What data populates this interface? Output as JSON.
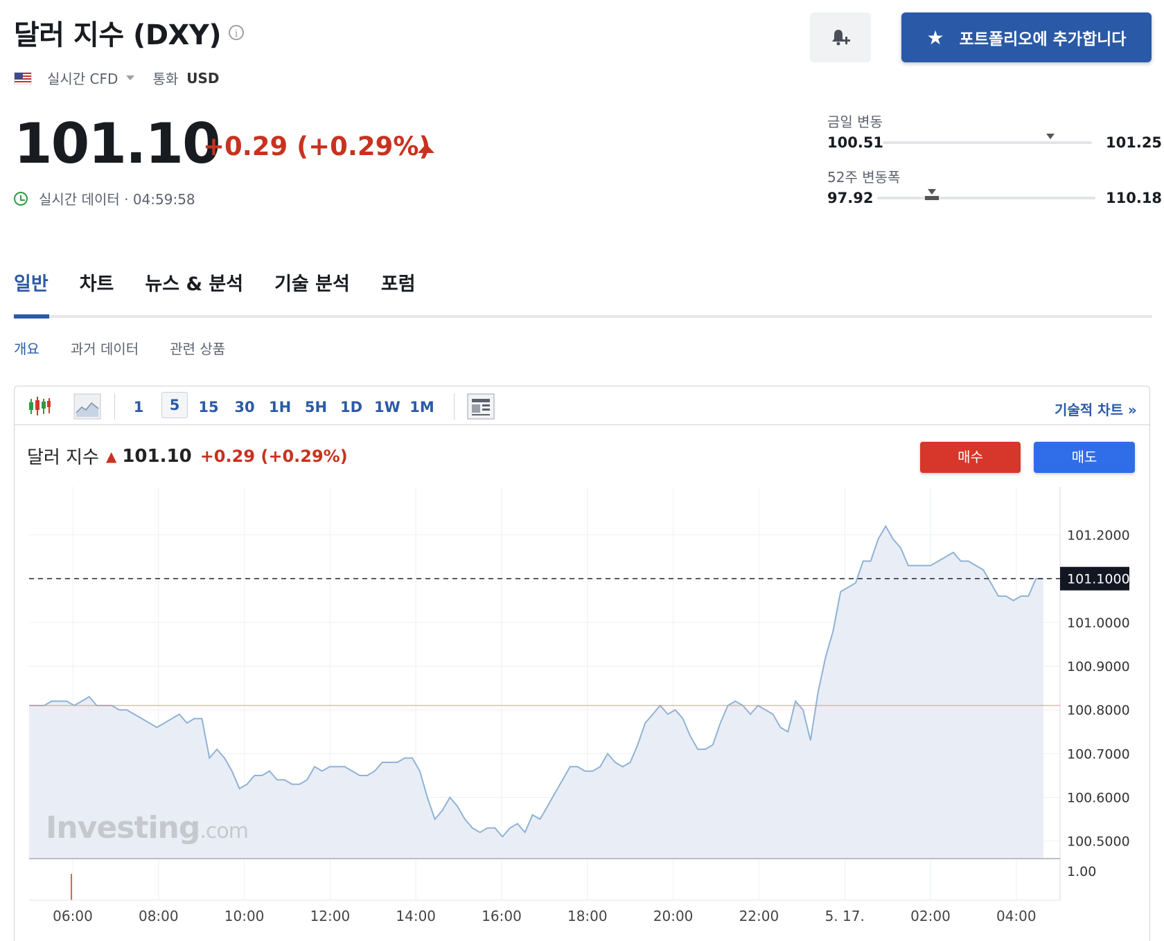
{
  "header": {
    "title": "달러 지수 (DXY)",
    "market_type": "실시간 CFD",
    "currency_label": "통화",
    "currency_value": "USD",
    "portfolio_button": "포트폴리오에 추가합니다"
  },
  "quote": {
    "price": "101.10",
    "change": "+0.29 (+0.29%)",
    "realtime": "실시간 데이터 · 04:59:58"
  },
  "ranges": {
    "day": {
      "label": "금일 변동",
      "low": "100.51",
      "high": "101.25",
      "current_fraction": 0.8
    },
    "week52": {
      "label": "52주 변동폭",
      "low": "97.92",
      "high": "110.18",
      "current_fraction": 0.25
    }
  },
  "tabs": [
    "일반",
    "차트",
    "뉴스 & 분석",
    "기술 분석",
    "포럼"
  ],
  "subtabs": [
    "개요",
    "과거 데이터",
    "관련 상품"
  ],
  "chart_toolbar": {
    "timeframes": [
      "1",
      "5",
      "15",
      "30",
      "1H",
      "5H",
      "1D",
      "1W",
      "1M"
    ],
    "selected": "5",
    "tech_chart_link": "기술적 차트 »"
  },
  "chart_header": {
    "name": "달러 지수",
    "value": "101.10",
    "change": "+0.29 (+0.29%)",
    "buy": "매수",
    "sell": "매도"
  },
  "watermark": {
    "brand": "Investing",
    "suffix": ".com"
  },
  "colors": {
    "accent": "#2a5aa7",
    "negative": "#c8321f",
    "line": "#8fb2d6",
    "fill": "#e9eef6"
  },
  "chart_data": {
    "type": "area",
    "x_labels": [
      "06:00",
      "08:00",
      "10:00",
      "12:00",
      "14:00",
      "16:00",
      "18:00",
      "20:00",
      "22:00",
      "5. 17.",
      "02:00",
      "04:00"
    ],
    "y_labels": [
      "101.2000",
      "101.1000",
      "101.0000",
      "100.9000",
      "100.8000",
      "100.7000",
      "100.6000",
      "100.5000"
    ],
    "ylim": [
      100.46,
      101.31
    ],
    "current_value": "101.1000",
    "previous_close": 100.81,
    "volume_label": "1.00",
    "values": [
      100.81,
      100.81,
      100.81,
      100.82,
      100.82,
      100.82,
      100.81,
      100.82,
      100.83,
      100.81,
      100.81,
      100.81,
      100.8,
      100.8,
      100.79,
      100.78,
      100.77,
      100.76,
      100.77,
      100.78,
      100.79,
      100.77,
      100.78,
      100.78,
      100.69,
      100.71,
      100.69,
      100.66,
      100.62,
      100.63,
      100.65,
      100.65,
      100.66,
      100.64,
      100.64,
      100.63,
      100.63,
      100.64,
      100.67,
      100.66,
      100.67,
      100.67,
      100.67,
      100.66,
      100.65,
      100.65,
      100.66,
      100.68,
      100.68,
      100.68,
      100.69,
      100.69,
      100.66,
      100.6,
      100.55,
      100.57,
      100.6,
      100.58,
      100.55,
      100.53,
      100.52,
      100.53,
      100.53,
      100.51,
      100.53,
      100.54,
      100.52,
      100.56,
      100.55,
      100.58,
      100.61,
      100.64,
      100.67,
      100.67,
      100.66,
      100.66,
      100.67,
      100.7,
      100.68,
      100.67,
      100.68,
      100.72,
      100.77,
      100.79,
      100.81,
      100.79,
      100.8,
      100.78,
      100.74,
      100.71,
      100.71,
      100.72,
      100.77,
      100.81,
      100.82,
      100.81,
      100.79,
      100.81,
      100.8,
      100.79,
      100.76,
      100.75,
      100.82,
      100.8,
      100.73,
      100.84,
      100.92,
      100.98,
      101.07,
      101.08,
      101.09,
      101.14,
      101.14,
      101.19,
      101.22,
      101.19,
      101.17,
      101.13,
      101.13,
      101.13,
      101.13,
      101.14,
      101.15,
      101.16,
      101.14,
      101.14,
      101.13,
      101.12,
      101.09,
      101.06,
      101.06,
      101.05,
      101.06,
      101.06,
      101.1,
      101.1
    ]
  }
}
